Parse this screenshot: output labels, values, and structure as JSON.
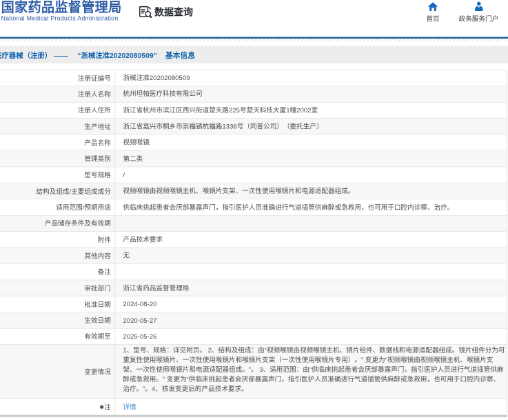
{
  "header": {
    "site_title_cn": "国家药品监督管理局",
    "site_title_en": "National Medical Products Administration",
    "section_title": "数据查询",
    "nav": [
      {
        "label": "首页",
        "icon": "home-icon"
      },
      {
        "label": "政务服务门户",
        "icon": "person-icon"
      }
    ],
    "colors": {
      "logo_blue": "#2e5ca8",
      "icon_blue": "#1268c3",
      "rule_dark": "#26618f"
    }
  },
  "breadcrumb": {
    "category": "医疗器械（注册）",
    "separator": "——",
    "title": "“浙械注准20202080509”",
    "suffix": "基本信息",
    "color": "#1565af"
  },
  "table": {
    "rows": [
      {
        "label": "注册证编号",
        "value": "浙械注准20202080509"
      },
      {
        "label": "注册人名称",
        "value": "杭州坦帕医疗科技有限公司"
      },
      {
        "label": "注册人住所",
        "value": "浙江省杭州市滨江区西兴街道楚天路225号楚天科技大厦1幢2002室"
      },
      {
        "label": "生产地址",
        "value": "浙江省嘉兴市桐乡市崇福镇杭福路1336号（同普公司）（委托生产）"
      },
      {
        "label": "产品名称",
        "value": "视频喉镜"
      },
      {
        "label": "管理类别",
        "value": "第二类"
      },
      {
        "label": "型号规格",
        "value": "/"
      },
      {
        "label": "结构及组成/主要组成成分",
        "value": "视频喉镜由视频喉镜主机、喉镜片支架、一次性使用喉镜片和电源适配器组成。"
      },
      {
        "label": "适用范围/预期用途",
        "value": "供临床挑起患者会厌部暴露声门，指引医护人员准确进行气道插管供麻醉或急救用，也可用于口腔内诊察、治疗。"
      },
      {
        "label": "产品储存条件及有效期",
        "value": ""
      },
      {
        "label": "附件",
        "value": "产品技术要求"
      },
      {
        "label": "其他内容",
        "value": "无"
      },
      {
        "label": "备注",
        "value": ""
      },
      {
        "label": "审批部门",
        "value": "浙江省药品监督管理局"
      },
      {
        "label": "批准日期",
        "value": "2024-08-20"
      },
      {
        "label": "生效日期",
        "value": "2020-05-27"
      },
      {
        "label": "有效期至",
        "value": "2025-05-26"
      },
      {
        "label": "变更情况",
        "value": "1、型号、规格：详见附页。 2、结构及组成：由“视频喉镜由视频喉镜主机、镜片组件、数据线和电源适配器组成。镜片组件分为可重复性使用喉镜片、一次性使用喉镜片和喉镜片支架（一次性使用喉镜片专用）。” 变更为“视频喉镜由视频喉镜主机、喉镜片支架、一次性使用喉镜片和电源适配器组成。”。 3、适用范围：由“供临床挑起患者会厌部暴露声门，指引医护人员进行气道插管供麻醉或急救用。” 变更为“供临床挑起患者会厌部暴露声门，指引医护人员准确进行气道插管供麻醉或急救用，也可用于口腔内诊察、治疗。”。4、核发变更后的产品技术要求。"
      },
      {
        "label": "●注",
        "value": "详情",
        "link": true
      }
    ]
  }
}
